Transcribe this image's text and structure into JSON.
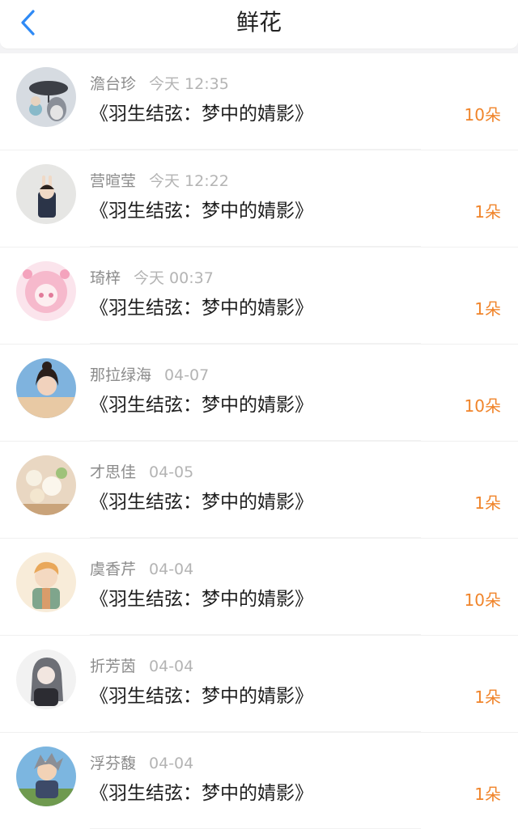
{
  "header": {
    "title": "鲜花",
    "back_icon": "chevron-left-icon",
    "accent_color": "#2f8af5"
  },
  "list": [
    {
      "name": "澹台珍",
      "time": "今天 12:35",
      "work": "《羽生结弦：梦中的婧影》",
      "count": "10朵"
    },
    {
      "name": "营暄莹",
      "time": "今天 12:22",
      "work": "《羽生结弦：梦中的婧影》",
      "count": "1朵"
    },
    {
      "name": "琦梓",
      "time": "今天 00:37",
      "work": "《羽生结弦：梦中的婧影》",
      "count": "1朵"
    },
    {
      "name": "那拉绿海",
      "time": "04-07",
      "work": "《羽生结弦：梦中的婧影》",
      "count": "10朵"
    },
    {
      "name": "才思佳",
      "time": "04-05",
      "work": "《羽生结弦：梦中的婧影》",
      "count": "1朵"
    },
    {
      "name": "虞香芹",
      "time": "04-04",
      "work": "《羽生结弦：梦中的婧影》",
      "count": "10朵"
    },
    {
      "name": "折芳茵",
      "time": "04-04",
      "work": "《羽生结弦：梦中的婧影》",
      "count": "1朵"
    },
    {
      "name": "浮芬馥",
      "time": "04-04",
      "work": "《羽生结弦：梦中的婧影》",
      "count": "1朵"
    }
  ],
  "colors": {
    "count": "#f0842a",
    "name": "#8c8c8c",
    "time": "#b4b4b4"
  }
}
